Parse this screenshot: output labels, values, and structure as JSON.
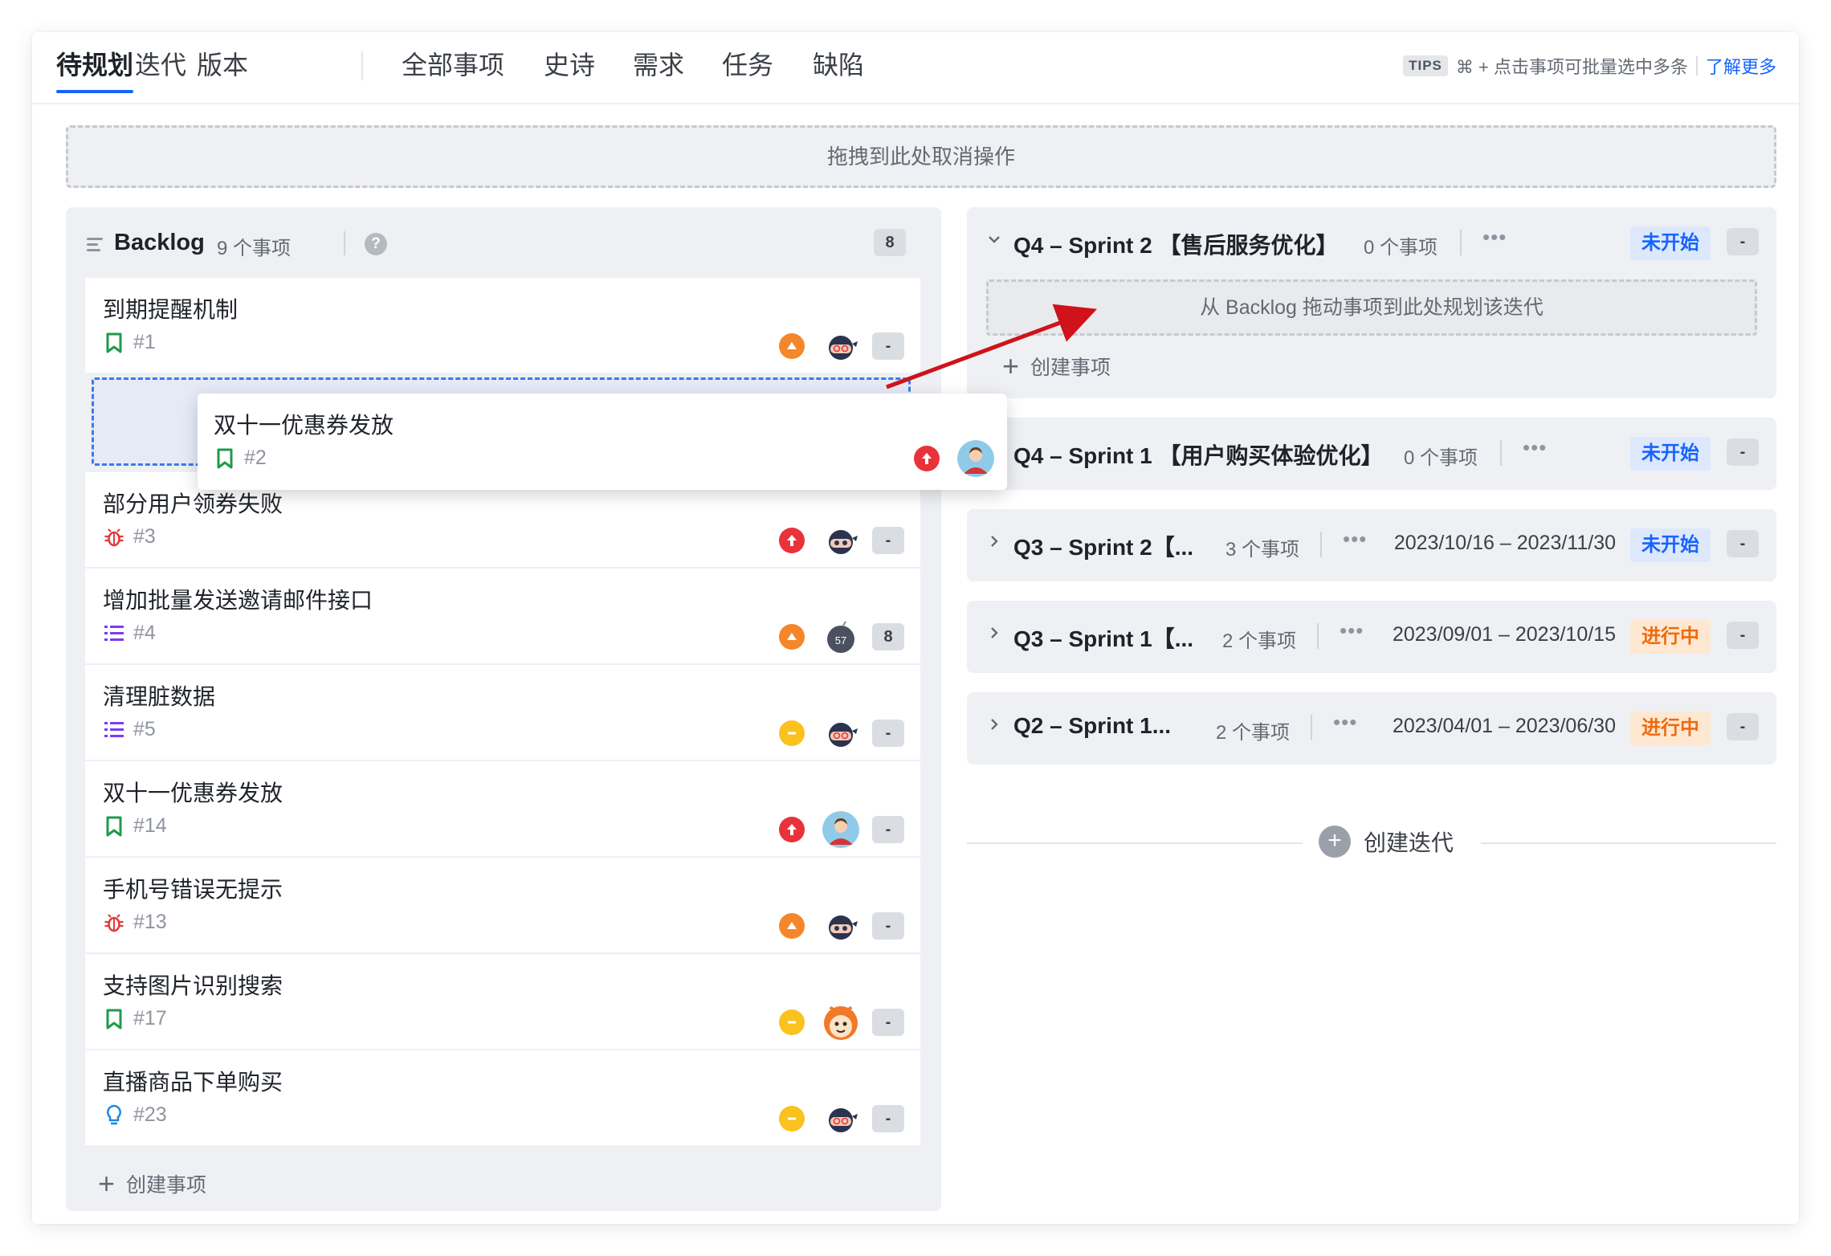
{
  "nav": {
    "tabs": [
      {
        "label": "待规划",
        "active": true
      },
      {
        "label": "迭代"
      },
      {
        "label": "版本"
      },
      {
        "label": "全部事项"
      },
      {
        "label": "史诗"
      },
      {
        "label": "需求"
      },
      {
        "label": "任务"
      },
      {
        "label": "缺陷"
      }
    ],
    "tips_badge": "TIPS",
    "tips_text": "⌘ + 点击事项可批量选中多条",
    "tips_link": "了解更多"
  },
  "dropzone": {
    "text": "拖拽到此处取消操作"
  },
  "backlog": {
    "title": "Backlog",
    "count": "9 个事项",
    "help": "?",
    "points": "8",
    "create": "创建事项",
    "items": [
      {
        "title": "到期提醒机制",
        "id": "#1",
        "type": "bookmark-icon",
        "priority": "mid",
        "avatar": "ninja",
        "points": "-"
      },
      {
        "title": "部分用户领券失败",
        "id": "#3",
        "type": "bug-icon",
        "priority": "high",
        "avatar": "ninja",
        "points": "-"
      },
      {
        "title": "增加批量发送邀请邮件接口",
        "id": "#4",
        "type": "task-list-icon",
        "priority": "mid",
        "avatar": "bomb",
        "avatar_text": "57",
        "points": "8"
      },
      {
        "title": "清理脏数据",
        "id": "#5",
        "type": "task-list-icon",
        "priority": "low",
        "avatar": "ninja",
        "points": "-"
      },
      {
        "title": "双十一优惠券发放",
        "id": "#14",
        "type": "bookmark-icon",
        "priority": "high",
        "avatar": "person",
        "points": "-"
      },
      {
        "title": "手机号错误无提示",
        "id": "#13",
        "type": "bug-icon",
        "priority": "mid",
        "avatar": "ninja",
        "points": "-"
      },
      {
        "title": "支持图片识别搜索",
        "id": "#17",
        "type": "bookmark-icon",
        "priority": "low",
        "avatar": "tiger",
        "points": "-"
      },
      {
        "title": "直播商品下单购买",
        "id": "#23",
        "type": "idea-icon",
        "priority": "low",
        "avatar": "ninja",
        "points": "-"
      }
    ]
  },
  "dragged": {
    "title": "双十一优惠券发放",
    "id": "#2"
  },
  "sprints": [
    {
      "name": "Q4 – Sprint 2 【售后服务优化】",
      "count": "0 个事项",
      "dates": "",
      "status": "未开始",
      "status_kind": "notstarted",
      "points": "-",
      "open": true,
      "drop_text": "从 Backlog 拖动事项到此处规划该迭代",
      "create": "创建事项"
    },
    {
      "name": "Q4 – Sprint 1 【用户购买体验优化】",
      "count": "0 个事项",
      "dates": "",
      "status": "未开始",
      "status_kind": "notstarted",
      "points": "-"
    },
    {
      "name": "Q3 – Sprint 2【...",
      "count": "3 个事项",
      "dates": "2023/10/16 – 2023/11/30",
      "status": "未开始",
      "status_kind": "notstarted",
      "points": "-"
    },
    {
      "name": "Q3 – Sprint 1【...",
      "count": "2 个事项",
      "dates": "2023/09/01 – 2023/10/15",
      "status": "进行中",
      "status_kind": "inprogress",
      "points": "-"
    },
    {
      "name": "Q2 – Sprint 1...",
      "count": "2 个事项",
      "dates": "2023/04/01 – 2023/06/30",
      "status": "进行中",
      "status_kind": "inprogress",
      "points": "-"
    }
  ],
  "new_sprint": {
    "label": "创建迭代"
  },
  "colors": {
    "accent": "#1664ff",
    "arrow": "#d0121b",
    "high": "#e8333a",
    "mid": "#f5862a",
    "low": "#fac21f"
  }
}
